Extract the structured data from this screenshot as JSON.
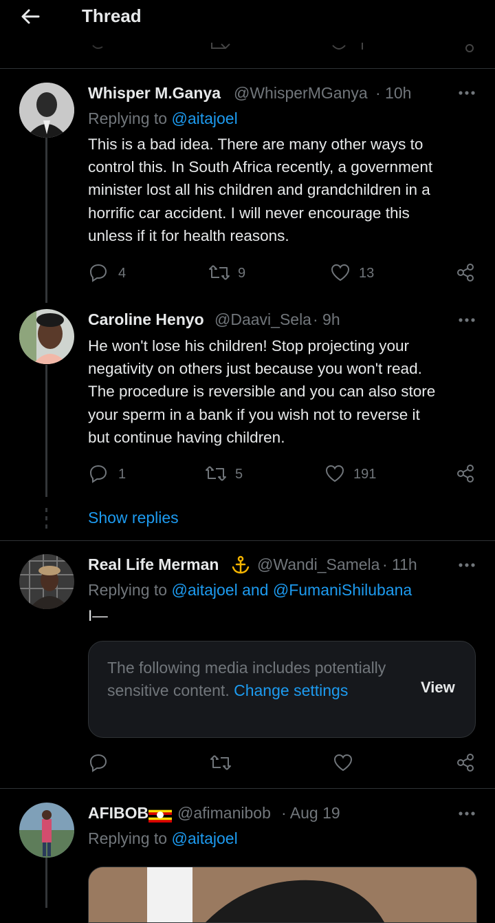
{
  "header": {
    "title": "Thread",
    "back_icon": "arrow-left-icon"
  },
  "tweets": [
    {
      "name": "Whisper M.Ganya",
      "handle": "@WhisperMGanya",
      "time": "· 10h",
      "replying_prefix": "Replying to",
      "replying_to": "@aitajoel",
      "text": "This is a bad idea. There are many other ways to control this. In South Africa recently, a government minister lost all his children and grandchildren in a horrific car accident. I will never encourage this unless if it for health reasons.",
      "lines": [
        "This is a bad idea. There are many other ways to",
        "control this. In South Africa recently, a government",
        "minister lost all his children and grandchildren in a",
        "horrific car accident. I will never encourage this",
        "unless if it for health reasons."
      ],
      "replies": "4",
      "retweets": "9",
      "likes": "13"
    },
    {
      "name": "Caroline Henyo",
      "handle": "@Daavi_Sela",
      "time": "· 9h",
      "lines": [
        "He won't lose his children! Stop projecting your",
        "negativity on others just because you won't read.",
        "The procedure is reversible and you can also store",
        "your sperm in a bank if you wish not to reverse it",
        "but continue having children."
      ],
      "replies": "1",
      "retweets": "5",
      "likes": "191"
    },
    {
      "name": "Real Life Merman",
      "handle": "@Wandi_Samela",
      "time": "· 11h",
      "replying_prefix": "Replying to",
      "replying_to": "@aitajoel and @FumaniShilubana",
      "text": "I—",
      "sensitive": {
        "text": "The following media includes potentially sensitive content.",
        "change_link": "Change settings",
        "view_label": "View"
      }
    },
    {
      "name": "AFIBOB",
      "handle": "@afimanibob",
      "time": "· Aug 19",
      "replying_prefix": "Replying to",
      "replying_to": "@aitajoel"
    }
  ],
  "show_replies": "Show replies",
  "colors": {
    "accent": "#1d9bf0",
    "muted": "#71767b",
    "background": "#000000",
    "border": "#2f3336"
  }
}
